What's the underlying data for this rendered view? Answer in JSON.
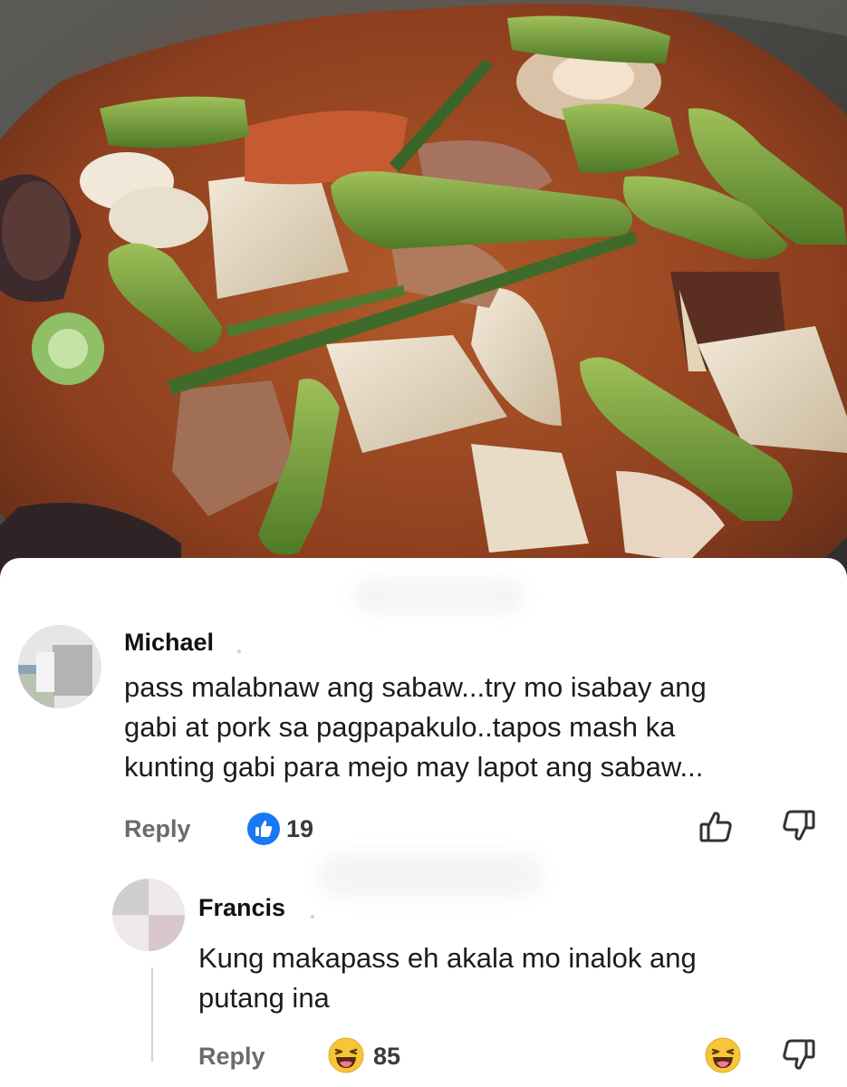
{
  "comments": [
    {
      "author": "Michael",
      "text_lines": [
        "pass malabnaw ang sabaw...try mo isabay ang",
        "gabi at pork sa pagpapakulo..tapos mash ka",
        "kunting gabi para mejo may lapot ang sabaw..."
      ],
      "reply_label": "Reply",
      "reaction_count": "19",
      "reaction_icon": "like-reaction-icon"
    },
    {
      "author": "Francis",
      "text_lines": [
        "Kung makapass eh akala mo inalok ang",
        "putang ina"
      ],
      "reply_label": "Reply",
      "reaction_count": "85",
      "reaction_icon": "haha-reaction-icon"
    }
  ],
  "colors": {
    "like_blue": "#1877f2",
    "haha_yellow": "#f7c53a",
    "muted_text": "#6b6b6b"
  }
}
